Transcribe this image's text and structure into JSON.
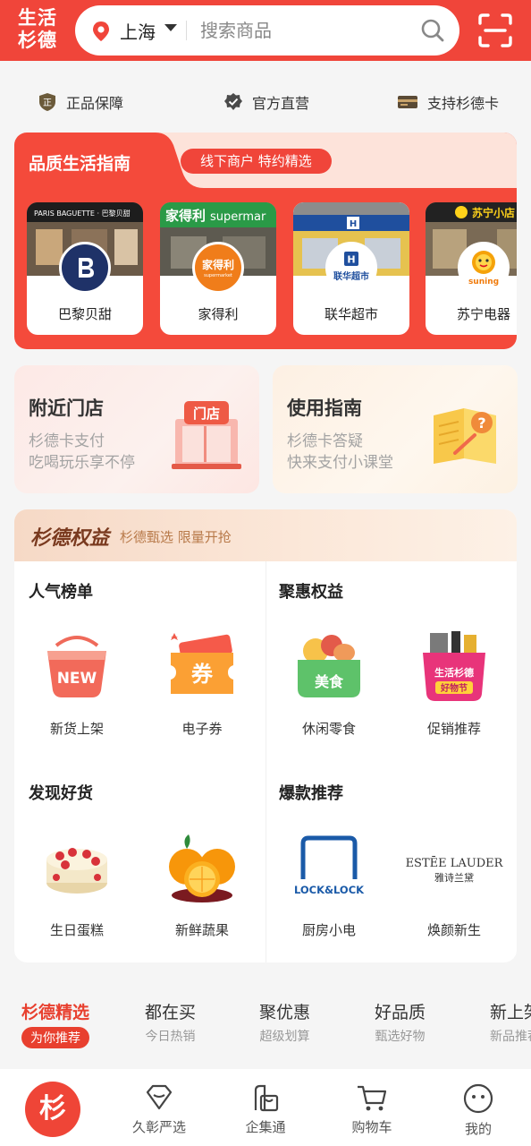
{
  "header": {
    "logo_line1": "生活",
    "logo_line2": "杉德",
    "city": "上海",
    "search_placeholder": "搜索商品"
  },
  "trust": [
    "正品保障",
    "官方直营",
    "支持杉德卡"
  ],
  "guide": {
    "title": "品质生活指南",
    "pill": "线下商户 特约精选",
    "stores": [
      {
        "name": "巴黎贝甜",
        "logo_caption": "巴黎贝甜"
      },
      {
        "name": "家得利",
        "logo_caption": "家得利"
      },
      {
        "name": "联华超市",
        "logo_caption": "联华超市"
      },
      {
        "name": "苏宁电器",
        "logo_caption": "suning"
      }
    ]
  },
  "promos": [
    {
      "title": "附近门店",
      "line1": "杉德卡支付",
      "line2": "吃喝玩乐享不停",
      "badge": "门店"
    },
    {
      "title": "使用指南",
      "line1": "杉德卡答疑",
      "line2": "快来支付小课堂"
    }
  ],
  "benefit": {
    "title": "杉德权益",
    "subtitle": "杉德甄选 限量开抢",
    "sections": [
      {
        "title": "人气榜单",
        "items": [
          "新货上架",
          "电子券"
        ]
      },
      {
        "title": "聚惠权益",
        "items": [
          "休闲零食",
          "促销推荐"
        ]
      },
      {
        "title": "发现好货",
        "items": [
          "生日蛋糕",
          "新鲜蔬果"
        ]
      },
      {
        "title": "爆款推荐",
        "items": [
          "厨房小电",
          "焕颜新生"
        ]
      }
    ],
    "icon_text": {
      "new": "NEW",
      "coupon": "券",
      "snack": "美食",
      "promo_line1": "生活杉德",
      "promo_line2": "好物节",
      "lock": "LOCK&LOCK",
      "estee_en": "ESTĒE LAUDER",
      "estee_cn": "雅诗兰黛"
    }
  },
  "category_tabs": [
    {
      "name": "杉德精选",
      "sub": "为你推荐",
      "active": true
    },
    {
      "name": "都在买",
      "sub": "今日热销"
    },
    {
      "name": "聚优惠",
      "sub": "超级划算"
    },
    {
      "name": "好品质",
      "sub": "甄选好物"
    },
    {
      "name": "新上架",
      "sub": "新品推荐"
    }
  ],
  "bottom_nav": {
    "home_glyph": "杉",
    "items": [
      "久彰严选",
      "企集通",
      "购物车",
      "我的"
    ]
  },
  "colors": {
    "brand_red": "#f0453a",
    "text_dark": "#222222",
    "muted": "#999999"
  }
}
